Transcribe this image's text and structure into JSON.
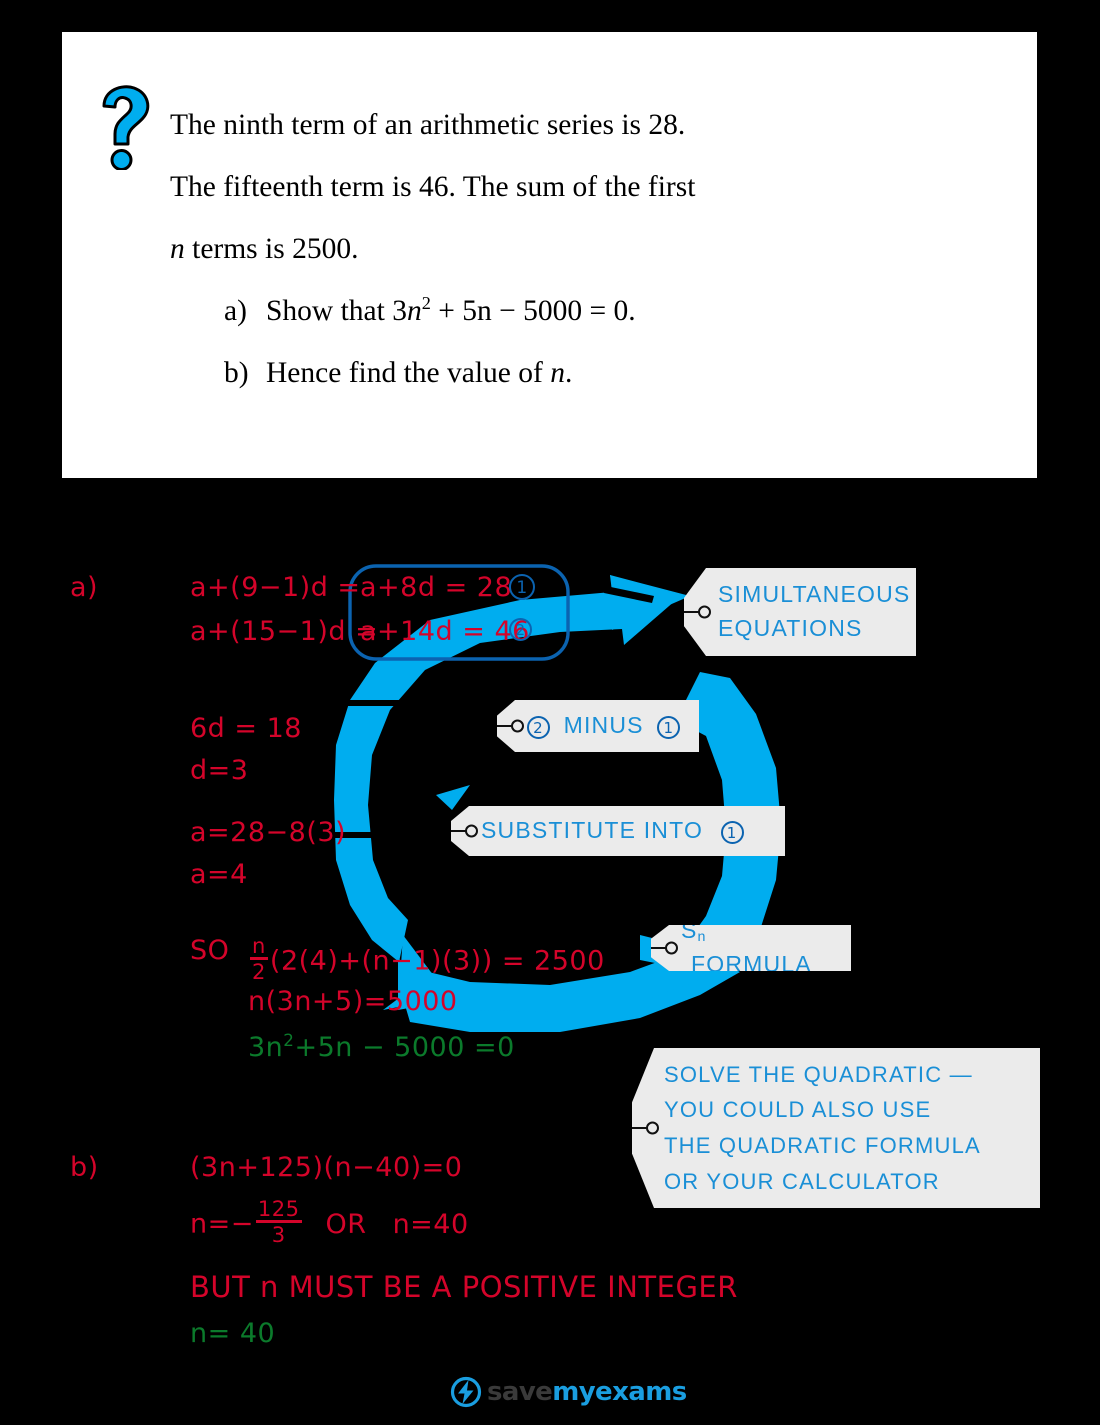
{
  "question": {
    "icon": "question-mark-icon",
    "lines": [
      "The ninth term of an arithmetic series is 28.",
      "The fifteenth term is 46.  The sum of the first"
    ],
    "line3_pre": "n",
    "line3_post": " terms is 2500.",
    "parts": [
      {
        "label": "a)",
        "text_pre": "Show that 3",
        "var": "n",
        "exp": "2",
        "text_post": " + 5n − 5000 = 0."
      },
      {
        "label": "b)",
        "text_pre": "Hence find the value of ",
        "var": "n",
        "exp": "",
        "text_post": "."
      }
    ]
  },
  "working": {
    "part_a_label": "a)",
    "part_b_label": "b)",
    "line_a1_left": "a+(9−1)d  =",
    "line_a1_boxed": "a+8d = 28",
    "line_a1_eqnum": "1",
    "line_a2_left": "a+(15−1)d =",
    "line_a2_boxed": "a+14d = 46",
    "line_a2_eqnum": "2",
    "line_6d": "6d = 18",
    "line_d": "d=3",
    "line_a_sub": "a=28−8(3)",
    "line_a_val": "a=4",
    "line_so_prefix": "SO",
    "line_so_num": "n",
    "line_so_den": "2",
    "line_so_rest": "(2(4)+(n−1)(3)) = 2500",
    "line_expand": "n(3n+5)=5000",
    "line_quadratic": "3n",
    "line_quadratic_exp": "2",
    "line_quadratic_rest": "+5n − 5000 =0",
    "line_factored": "(3n+125)(n−40)=0",
    "line_roots_pre": "n=−",
    "line_roots_num": "125",
    "line_roots_den": "3",
    "line_roots_or": "OR",
    "line_roots_second": "n=40",
    "line_but": "BUT  n  MUST  BE  A  POSITIVE   INTEGER",
    "line_answer": "n= 40"
  },
  "callouts": [
    {
      "name": "simultaneous-equations-tag",
      "lines": [
        "SIMULTANEOUS",
        "EQUATIONS"
      ]
    },
    {
      "name": "minus-tag",
      "prefix_circle": "2",
      "middle": "MINUS",
      "suffix_circle": "1"
    },
    {
      "name": "substitute-tag",
      "text": "SUBSTITUTE   INTO",
      "suffix_circle": "1"
    },
    {
      "name": "sn-formula-tag",
      "sym": "S",
      "sub": "n",
      "text": "FORMULA"
    },
    {
      "name": "solve-quadratic-tag",
      "lines": [
        "SOLVE   THE  QUADRATIC —",
        "YOU   COULD   ALSO   USE",
        "THE   QUADRATIC   FORMULA",
        "OR   YOUR   CALCULATOR"
      ]
    }
  ],
  "logo": {
    "word1": "save",
    "word2": "my",
    "word3": "exams",
    "icon": "lightning-bolt-circle-icon"
  },
  "colors": {
    "arrow_blue": "#00ADEF",
    "tag_blue": "#1a8fd6",
    "handwriting_red": "#d4042a",
    "handwriting_green": "#0b7a2b",
    "loop_blue": "#0b63b0",
    "background": "#000000",
    "card": "#ffffff"
  }
}
